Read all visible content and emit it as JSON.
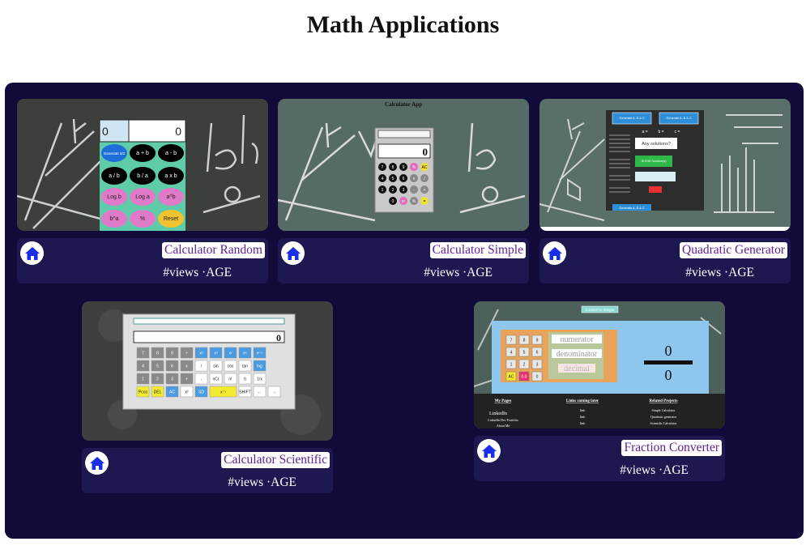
{
  "page": {
    "title": "Math Applications"
  },
  "home_icon": "home-icon",
  "colors": {
    "panel_bg": "#120a38",
    "info_bg": "#1e1850",
    "link_text": "#5a1f90",
    "home_icon": "#1a2ee8"
  },
  "apps": [
    {
      "name": "Calculator Random",
      "meta": "#views ·AGE",
      "thumb_header": ""
    },
    {
      "name": "Calculator Simple",
      "meta": "#views ·AGE",
      "thumb_header": "Calculator App"
    },
    {
      "name": "Quadratic Generator",
      "meta": "#views ·AGE",
      "thumb_header": ""
    },
    {
      "name": "Calculator Scientific",
      "meta": "#views ·AGE",
      "thumb_header": ""
    },
    {
      "name": "Fraction Converter",
      "meta": "#views ·AGE",
      "thumb_header": ""
    }
  ],
  "thumbs": {
    "random": {
      "display": [
        "0",
        "0"
      ],
      "keys": [
        "Generate 0/2",
        "a + b",
        "a - b",
        "a / b",
        "b / a",
        "a x b",
        "Log b",
        "Log a",
        "a^b",
        "b^a",
        "%",
        "Reset"
      ]
    },
    "simple": {
      "display": "0",
      "keys": [
        "7",
        "8",
        "9",
        "%",
        "AC",
        "4",
        "5",
        "6",
        "x",
        "/",
        "1",
        "2",
        "3",
        "-",
        "+",
        "0",
        "x²",
        "%",
        "="
      ]
    },
    "quadratic": {
      "buttons": [
        "Generate A, B & C",
        "Generate A, B & C",
        "Any solutions?",
        "SHOW Solution(s)",
        "Generate A, B & C"
      ],
      "labels": [
        "a =",
        "b =",
        "c ="
      ]
    },
    "scientific": {
      "display": "0",
      "keys": [
        "7",
        "8",
        "9",
        "÷",
        "x²",
        "x³",
        "xʸ",
        "eˣ",
        "e⁻ˣ",
        "4",
        "5",
        "6",
        "x",
        "/",
        "sin",
        "cos",
        "tan",
        "log",
        "1",
        "2",
        "3",
        "+",
        "-",
        "nCr",
        "n!",
        "π",
        "1/x",
        "Pcos",
        "DEL",
        "AC",
        "x²",
        "SD",
        "x⁻¹",
        "SHIFT",
        "←",
        "→",
        "="
      ]
    },
    "fraction": {
      "top_button": "Convert to Simple",
      "fields": [
        "numerator",
        "denominator",
        "decimal"
      ],
      "numerator": "0",
      "denominator": "0",
      "keys": [
        "7",
        "8",
        "9",
        "4",
        "5",
        "6",
        "1",
        "2",
        "3",
        "AC",
        "0.0",
        "0"
      ],
      "footer": {
        "col1_title": "My Pages",
        "col1_items": [
          "LinkedIn",
          "LinkedIn Dev Portfolio",
          "About Me"
        ],
        "col2_title": "Links coming later",
        "col2_items": [
          "link",
          "link",
          "link"
        ],
        "col3_title": "Related Projects",
        "col3_items": [
          "Simple Calculator",
          "Quadratic generator",
          "Scientific Calculator"
        ]
      }
    }
  }
}
